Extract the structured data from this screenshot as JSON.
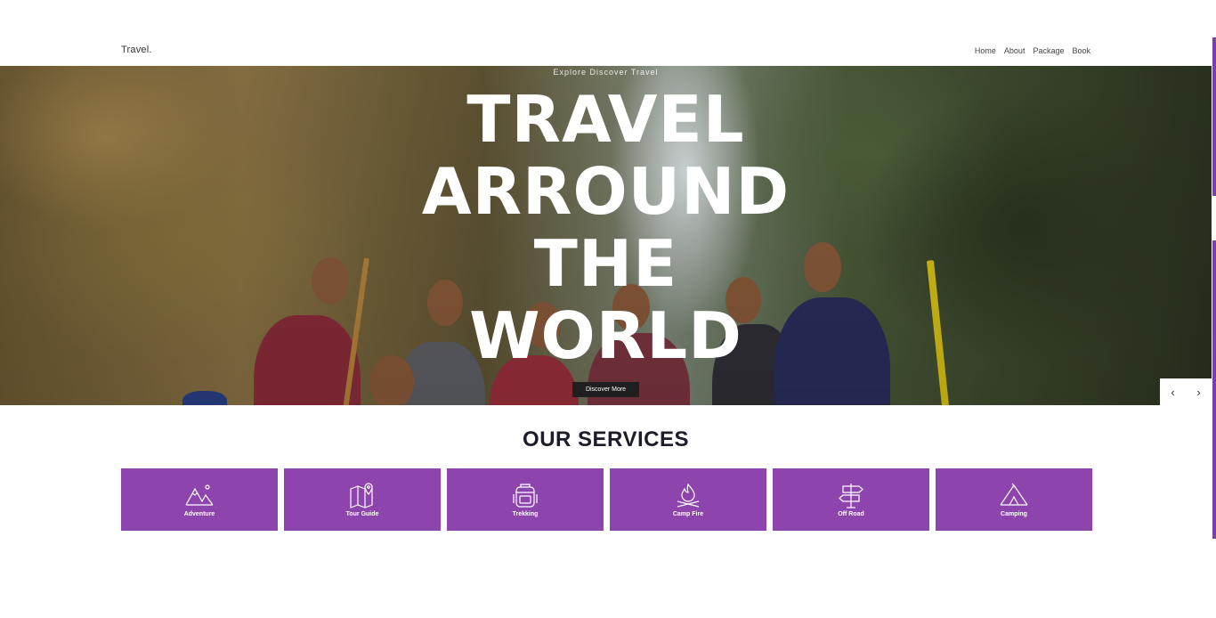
{
  "nav": {
    "brand": "Travel.",
    "links": [
      "Home",
      "About",
      "Package",
      "Book"
    ]
  },
  "hero": {
    "tagline": "Explore  Discover  Travel",
    "title_lines": [
      "TRAVEL",
      "ARROUND",
      "THE",
      "WORLD"
    ],
    "cta_label": "Discover More",
    "prev_label": "‹",
    "next_label": "›"
  },
  "services": {
    "title": "OUR SERVICES",
    "items": [
      {
        "label": "Adventure",
        "icon": "mountain-icon"
      },
      {
        "label": "Tour Guide",
        "icon": "map-pin-icon"
      },
      {
        "label": "Trekking",
        "icon": "backpack-icon"
      },
      {
        "label": "Camp Fire",
        "icon": "campfire-icon"
      },
      {
        "label": "Off Road",
        "icon": "signpost-icon"
      },
      {
        "label": "Camping",
        "icon": "tent-icon"
      }
    ]
  },
  "colors": {
    "accent": "#8e44ad",
    "cta_bg": "#1f1f1f",
    "title": "#1c1c2b"
  }
}
